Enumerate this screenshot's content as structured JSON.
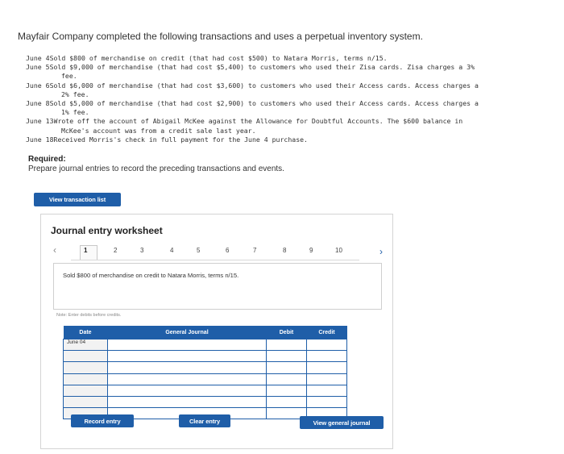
{
  "header": {
    "intro": "Mayfair Company completed the following transactions and uses a perpetual inventory system."
  },
  "transactions": [
    {
      "date": "June 4 ",
      "lines": [
        "Sold $800 of merchandise on credit (that had cost $500) to Natara Morris, terms n/15."
      ]
    },
    {
      "date": "June 5 ",
      "lines": [
        "Sold $9,000 of merchandise (that had cost $5,400) to customers who used their Zisa cards. Zisa charges a 3%",
        "fee."
      ]
    },
    {
      "date": "June 6 ",
      "lines": [
        "Sold $6,000 of merchandise (that had cost $3,600) to customers who used their Access cards. Access charges a",
        "2% fee."
      ]
    },
    {
      "date": "June 8 ",
      "lines": [
        "Sold $5,000 of merchandise (that had cost $2,900) to customers who used their Access cards. Access charges a",
        "1% fee."
      ]
    },
    {
      "date": "June 13 ",
      "lines": [
        "Wrote off the account of Abigail McKee against the Allowance for Doubtful Accounts. The $600 balance in",
        "McKee's account was from a credit sale last year."
      ]
    },
    {
      "date": "June 18 ",
      "lines": [
        "Received Morris's check in full payment for the June 4 purchase."
      ]
    }
  ],
  "required": {
    "label": "Required:",
    "text": "Prepare journal entries to record the preceding transactions and events."
  },
  "buttons": {
    "view_transaction_list": "View transaction list",
    "record_entry": "Record entry",
    "clear_entry": "Clear entry",
    "view_general_journal": "View general journal"
  },
  "worksheet": {
    "title": "Journal entry worksheet",
    "pages": [
      "1",
      "2",
      "3",
      "4",
      "5",
      "6",
      "7",
      "8",
      "9",
      "10"
    ],
    "active_page": "1",
    "prev_icon": "chevron-left-icon",
    "next_icon": "chevron-right-icon",
    "description": "Sold $800 of merchandise on credit to Natara Morris, terms n/15.",
    "note": "Note: Enter debits before credits.",
    "columns": {
      "date": "Date",
      "journal": "General Journal",
      "debit": "Debit",
      "credit": "Credit"
    },
    "rows": [
      {
        "date": "June 04"
      },
      {
        "date": ""
      },
      {
        "date": ""
      },
      {
        "date": ""
      },
      {
        "date": ""
      },
      {
        "date": ""
      },
      {
        "date": ""
      }
    ]
  },
  "colors": {
    "accent": "#1f5ea8"
  }
}
